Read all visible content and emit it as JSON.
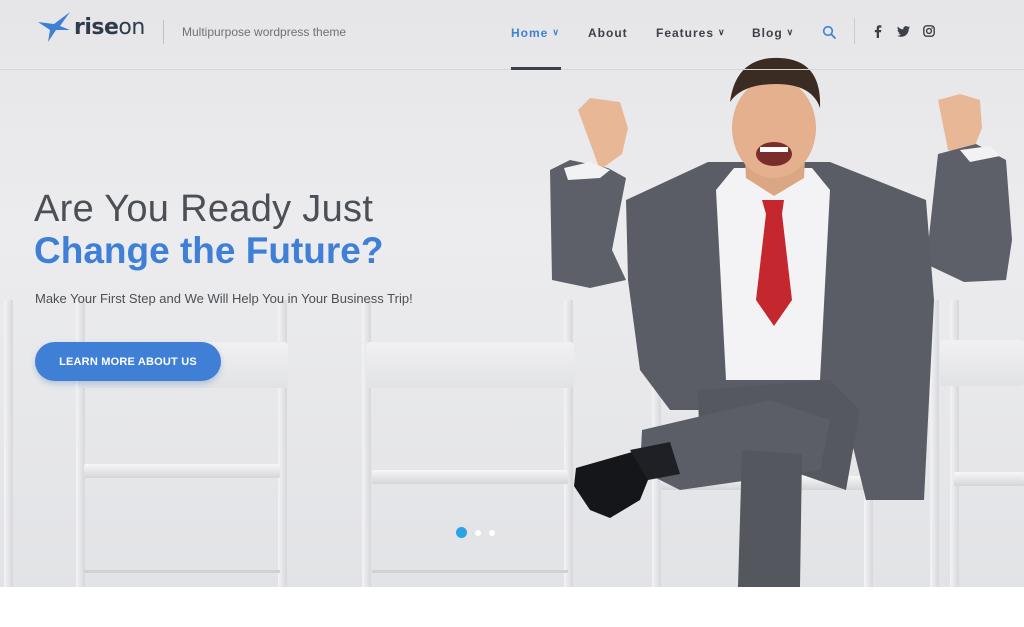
{
  "brand": {
    "name_bold": "rise",
    "name_light": "on",
    "tagline": "Multipurpose wordpress theme",
    "accent_color": "#3f80d6"
  },
  "nav": {
    "items": [
      {
        "label": "Home",
        "active": true,
        "has_dropdown": true
      },
      {
        "label": "About",
        "active": false,
        "has_dropdown": false
      },
      {
        "label": "Features",
        "active": false,
        "has_dropdown": true
      },
      {
        "label": "Blog",
        "active": false,
        "has_dropdown": true
      }
    ],
    "search_icon": "search-icon",
    "social": [
      "facebook-icon",
      "twitter-icon",
      "instagram-icon"
    ]
  },
  "hero": {
    "headline_line1": "Are You Ready Just",
    "headline_line2": "Change the Future?",
    "subline": "Make Your First Step and We Will Help You in Your Business Trip!",
    "cta_label": "LEARN MORE ABOUT US",
    "slider": {
      "total": 3,
      "active": 1
    }
  }
}
